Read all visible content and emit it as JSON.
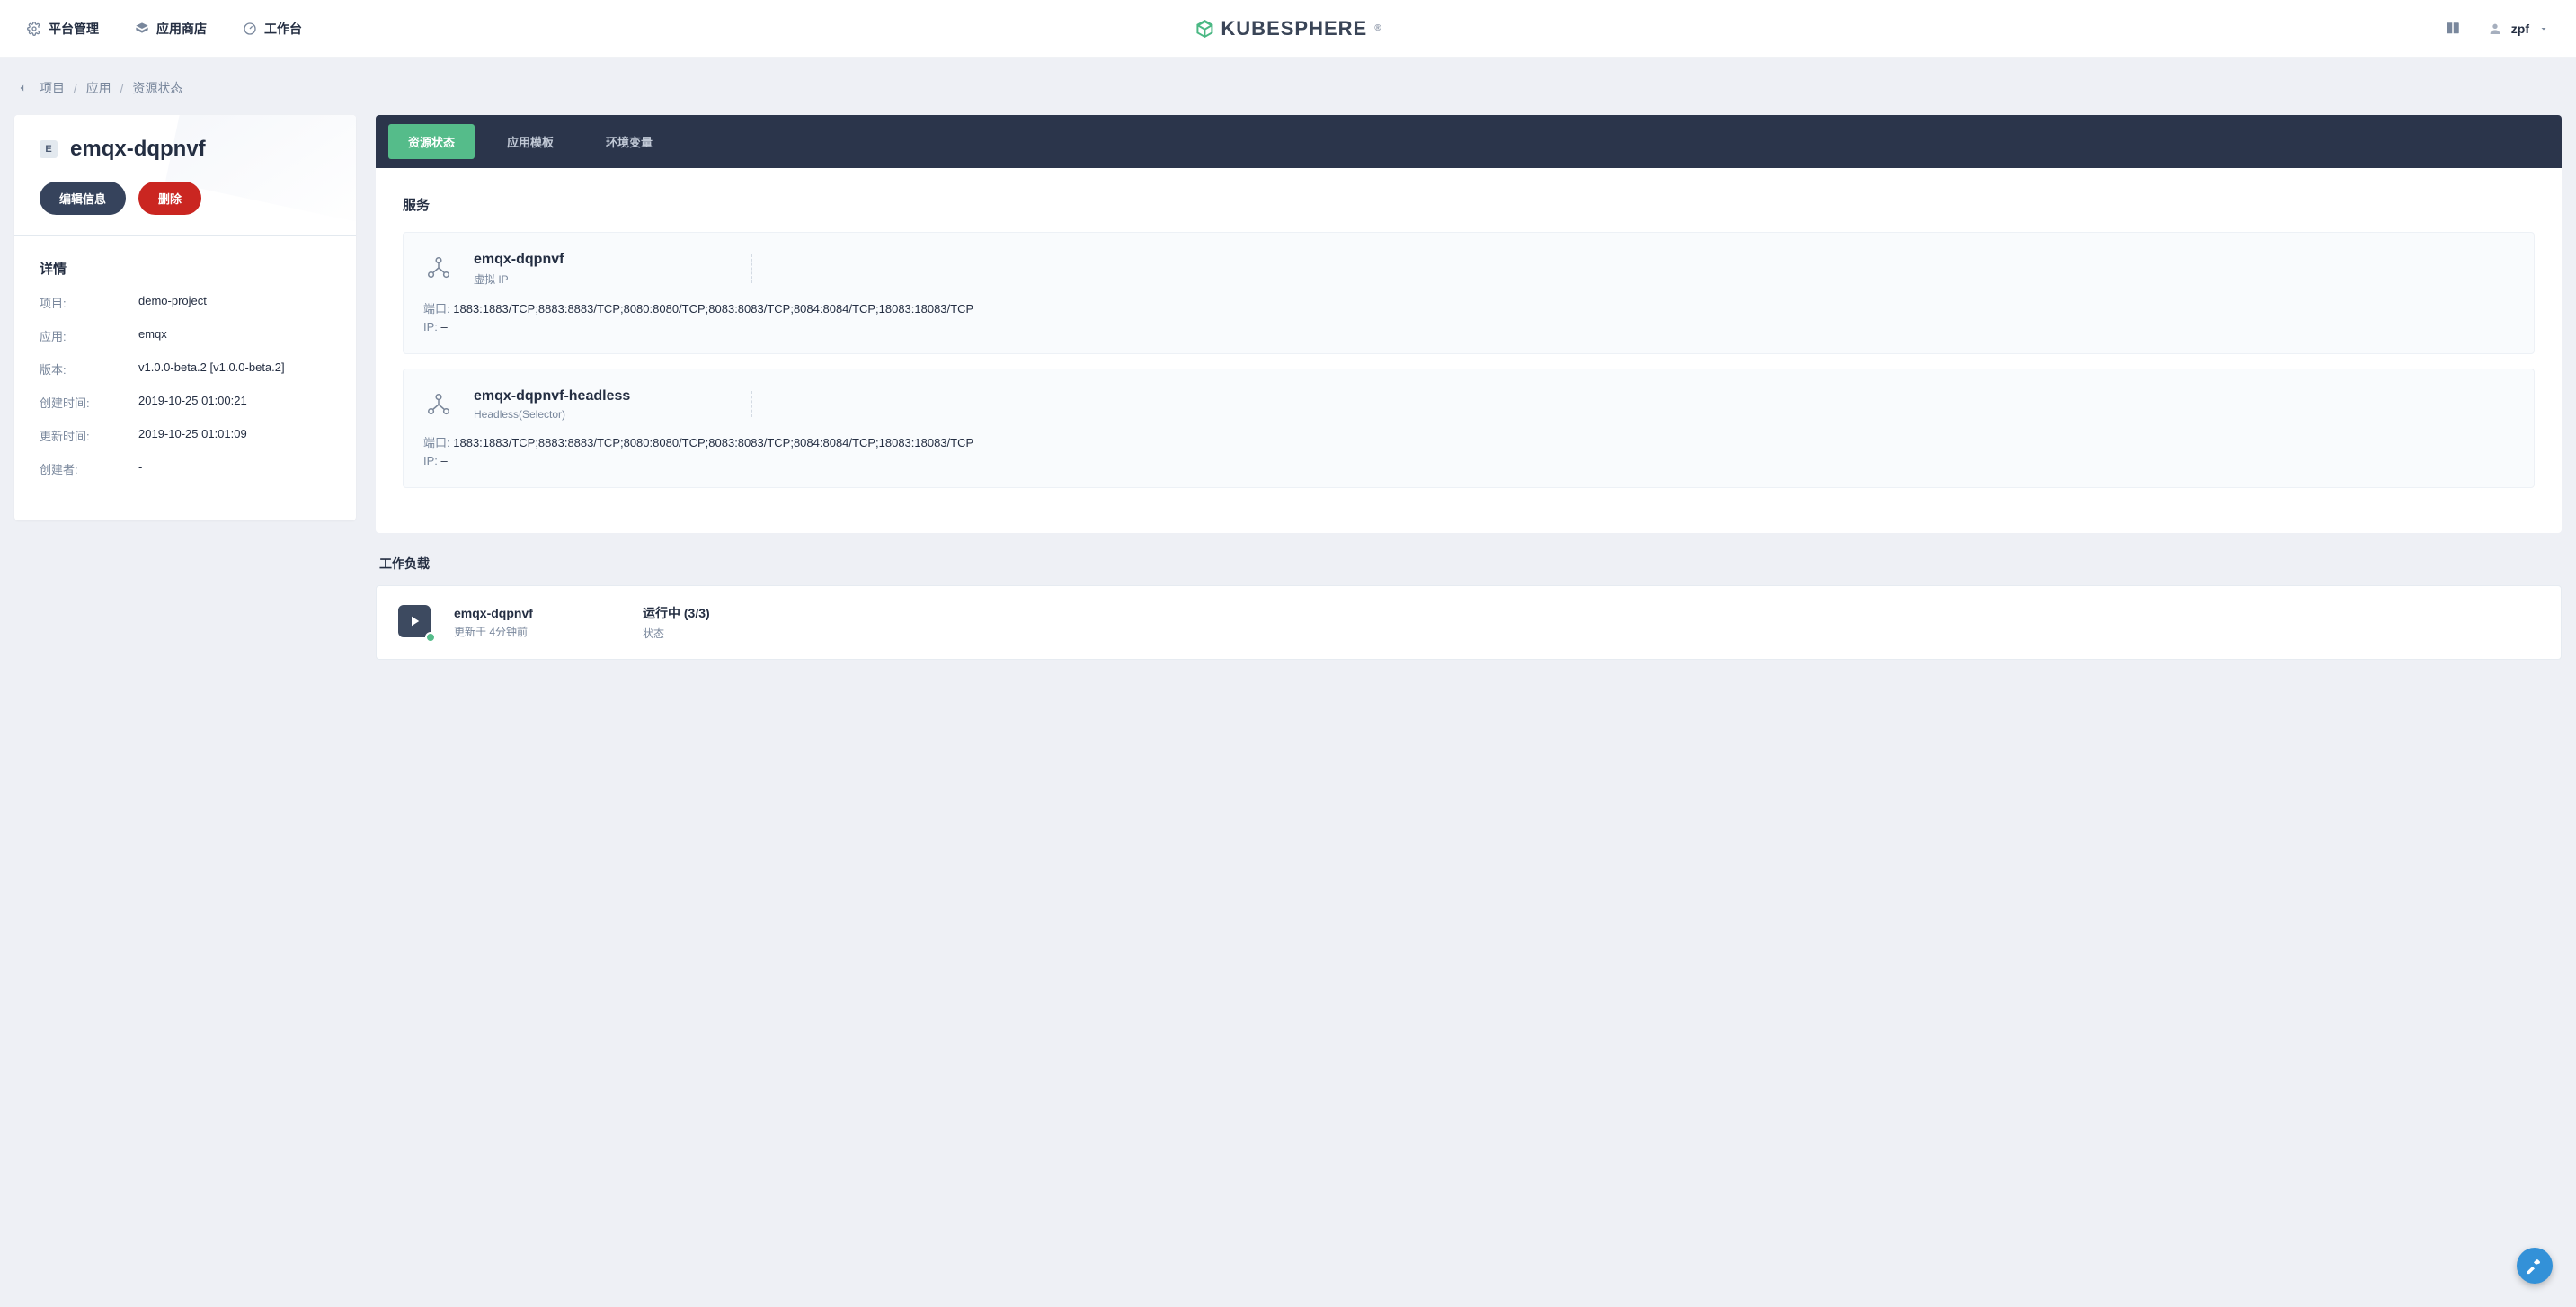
{
  "topnav": {
    "platform_management": "平台管理",
    "app_store": "应用商店",
    "workbench": "工作台"
  },
  "brand": {
    "name": "KUBESPHERE",
    "mark": "®"
  },
  "user": {
    "name": "zpf"
  },
  "breadcrumb": {
    "project": "项目",
    "application": "应用",
    "resource_status": "资源状态"
  },
  "detail": {
    "badge": "E",
    "title": "emqx-dqpnvf",
    "edit_label": "编辑信息",
    "delete_label": "删除",
    "section_title": "详情",
    "rows": {
      "project_label": "项目:",
      "project_value": "demo-project",
      "app_label": "应用:",
      "app_value": "emqx",
      "version_label": "版本:",
      "version_value": "v1.0.0-beta.2 [v1.0.0-beta.2]",
      "created_label": "创建时间:",
      "created_value": "2019-10-25 01:00:21",
      "updated_label": "更新时间:",
      "updated_value": "2019-10-25 01:01:09",
      "creator_label": "创建者:",
      "creator_value": "-"
    }
  },
  "tabs": {
    "resource_status": "资源状态",
    "app_template": "应用模板",
    "env_vars": "环境变量"
  },
  "services": {
    "title": "服务",
    "port_label": "端口:",
    "ip_label": "IP:",
    "items": [
      {
        "name": "emqx-dqpnvf",
        "type": "虚拟 IP",
        "ports": "1883:1883/TCP;8883:8883/TCP;8080:8080/TCP;8083:8083/TCP;8084:8084/TCP;18083:18083/TCP",
        "ip": "–"
      },
      {
        "name": "emqx-dqpnvf-headless",
        "type": "Headless(Selector)",
        "ports": "1883:1883/TCP;8883:8883/TCP;8080:8080/TCP;8083:8083/TCP;8084:8084/TCP;18083:18083/TCP",
        "ip": "–"
      }
    ]
  },
  "workloads": {
    "title": "工作负载",
    "items": [
      {
        "name": "emqx-dqpnvf",
        "updated": "更新于 4分钟前",
        "status": "运行中 (3/3)",
        "status_label": "状态"
      }
    ]
  }
}
